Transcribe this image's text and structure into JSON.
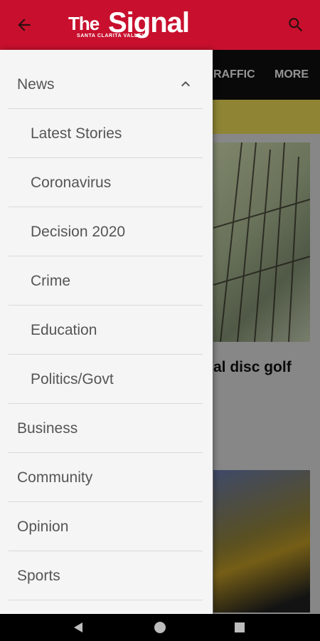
{
  "app": {
    "logo_text_the": "The",
    "logo_text_signal": "Signal",
    "logo_tagline": "SANTA CLARITA VALLEY"
  },
  "background": {
    "tabs": [
      {
        "label": "RAFFIC"
      },
      {
        "label": "MORE"
      }
    ],
    "headline_fragment": "al disc golf"
  },
  "drawer": {
    "sections": [
      {
        "label": "News",
        "expanded": true
      },
      {
        "label": "Latest Stories"
      },
      {
        "label": "Coronavirus"
      },
      {
        "label": "Decision 2020"
      },
      {
        "label": "Crime"
      },
      {
        "label": "Education"
      },
      {
        "label": "Politics/Govt"
      },
      {
        "label": "Business"
      },
      {
        "label": "Community"
      },
      {
        "label": "Opinion"
      },
      {
        "label": "Sports"
      }
    ]
  },
  "icons": {
    "back": "arrow-left-icon",
    "search": "search-icon",
    "collapse": "chevron-up-icon",
    "system_back": "triangle-back-icon",
    "system_home": "circle-home-icon",
    "system_recents": "square-recents-icon"
  },
  "colors": {
    "brand_red": "#c8102e",
    "drawer_bg": "#f5f5f5",
    "accent_yellow": "#f5e35a"
  }
}
